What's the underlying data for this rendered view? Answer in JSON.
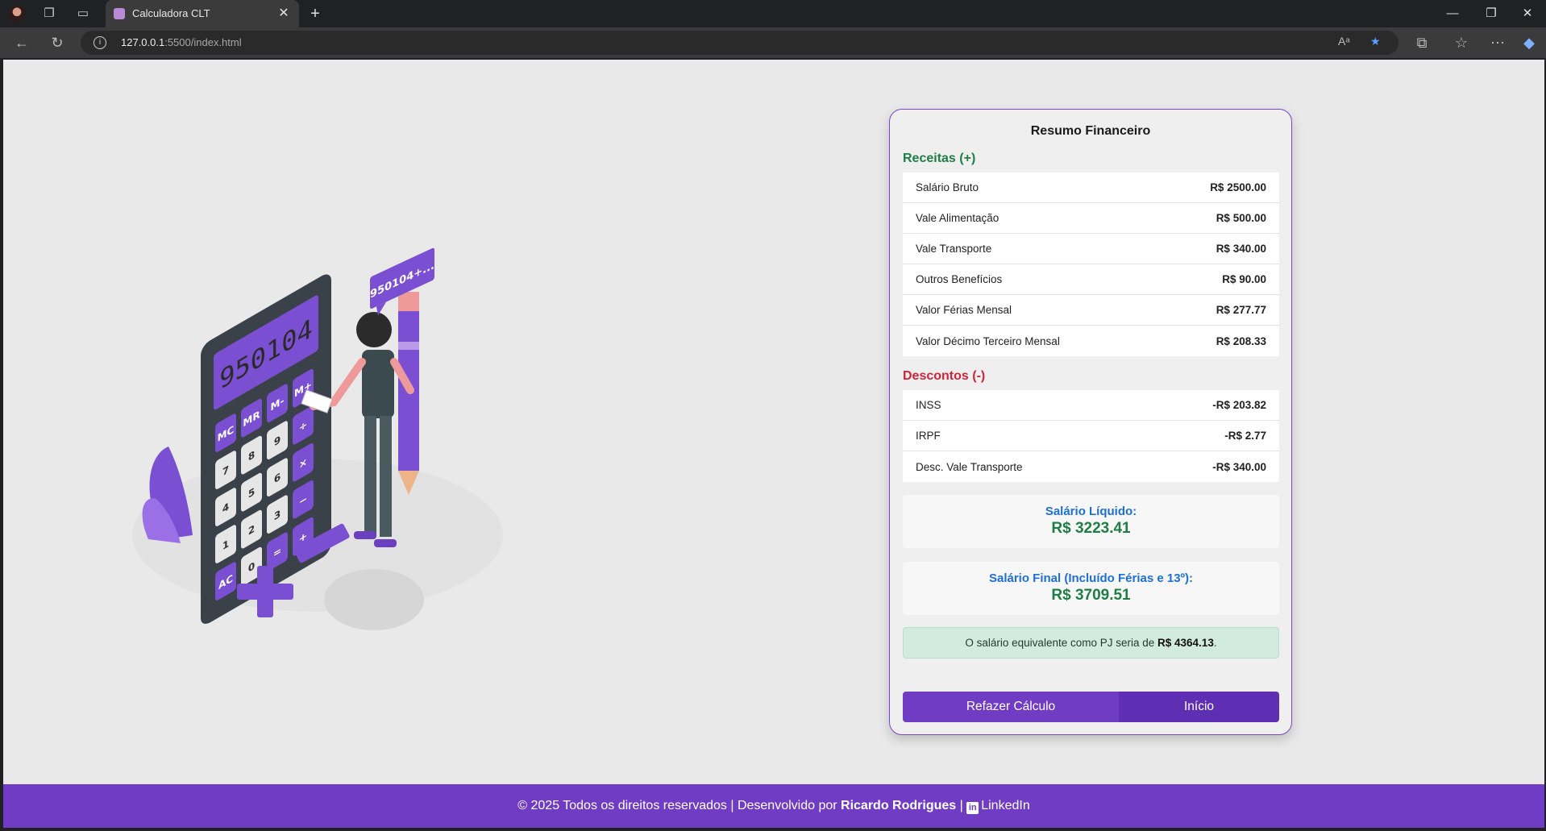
{
  "browser": {
    "tab_title": "Calculadora CLT",
    "url_host": "127.0.0.1",
    "url_rest": ":5500/index.html"
  },
  "card": {
    "title": "Resumo Financeiro",
    "receitas_heading": "Receitas (+)",
    "receitas": [
      {
        "label": "Salário Bruto",
        "value": "R$ 2500.00"
      },
      {
        "label": "Vale Alimentação",
        "value": "R$ 500.00"
      },
      {
        "label": "Vale Transporte",
        "value": "R$ 340.00"
      },
      {
        "label": "Outros Benefícios",
        "value": "R$ 90.00"
      },
      {
        "label": "Valor Férias Mensal",
        "value": "R$ 277.77"
      },
      {
        "label": "Valor Décimo Terceiro Mensal",
        "value": "R$ 208.33"
      }
    ],
    "descontos_heading": "Descontos (-)",
    "descontos": [
      {
        "label": "INSS",
        "value": "-R$ 203.82"
      },
      {
        "label": "IRPF",
        "value": "-R$ 2.77"
      },
      {
        "label": "Desc. Vale Transporte",
        "value": "-R$ 340.00"
      }
    ],
    "liquido_label": "Salário Líquido:",
    "liquido_value": "R$ 3223.41",
    "final_label": "Salário Final (Incluído Férias e 13º):",
    "final_value": "R$ 3709.51",
    "pj_text_prefix": "O salário equivalente como PJ seria de ",
    "pj_value": "R$ 4364.13",
    "pj_text_suffix": ".",
    "redo_button": "Refazer Cálculo",
    "home_button": "Início"
  },
  "illustration": {
    "display": "950104",
    "bubble": "950104+...",
    "keys": [
      "MC",
      "MR",
      "M-",
      "M+",
      "7",
      "8",
      "9",
      "÷",
      "4",
      "5",
      "6",
      "×",
      "1",
      "2",
      "3",
      "−",
      "AC",
      "0",
      "=",
      "+"
    ]
  },
  "footer": {
    "prefix": "© 2025 Todos os direitos reservados | Desenvolvido por ",
    "author": "Ricardo Rodrigues",
    "sep": " | ",
    "linkedin": "LinkedIn"
  },
  "colors": {
    "accent": "#6f3cc3",
    "green": "#1e7e45",
    "red": "#d0243a",
    "blue": "#1d6fd6"
  }
}
